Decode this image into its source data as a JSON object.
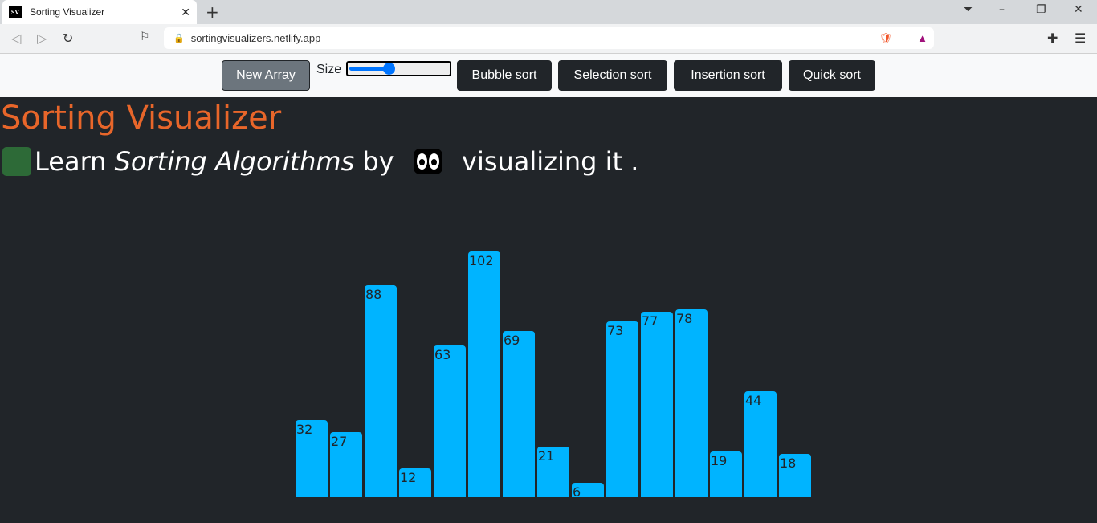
{
  "browser": {
    "tab_title": "Sorting Visualizer",
    "favicon_text": "SV",
    "url": "sortingvisualizers.netlify.app"
  },
  "navbar": {
    "new_array": "New Array",
    "size_label": "Size",
    "size_value_fraction": 0.4,
    "algorithms": [
      "Bubble sort",
      "Selection sort",
      "Insertion sort",
      "Quick sort"
    ]
  },
  "page": {
    "title": "Sorting Visualizer",
    "sub_learn": "Learn ",
    "sub_emph": "Sorting Algorithms",
    "sub_by": " by ",
    "sub_end": " visualizing it ."
  },
  "colors": {
    "bar": "#00b4ff",
    "title": "#e8662a",
    "background": "#212529"
  },
  "chart_data": {
    "type": "bar",
    "values": [
      32,
      27,
      88,
      12,
      63,
      102,
      69,
      21,
      6,
      73,
      77,
      78,
      19,
      44,
      18
    ]
  }
}
